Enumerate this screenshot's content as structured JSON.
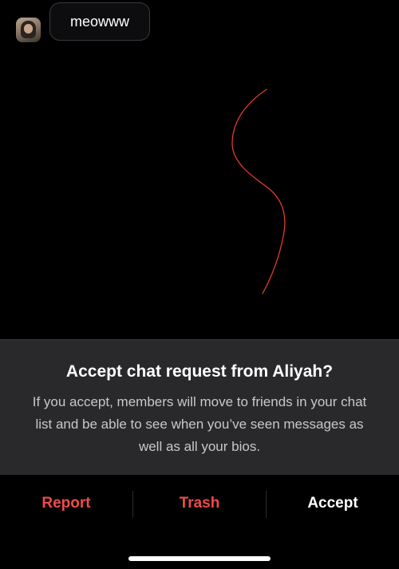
{
  "chat": {
    "message_text": "meowww"
  },
  "drawing": {
    "stroke_color": "#e03a32"
  },
  "request_sheet": {
    "title": "Accept chat request from Aliyah?",
    "body": "If you accept, members will move to friends in your chat list and be able to see when you’ve seen messages as well as all your bios."
  },
  "actions": {
    "report_label": "Report",
    "trash_label": "Trash",
    "accept_label": "Accept"
  },
  "colors": {
    "danger": "#ef4b4b",
    "sheet_background": "#29292b",
    "background": "#000000"
  }
}
